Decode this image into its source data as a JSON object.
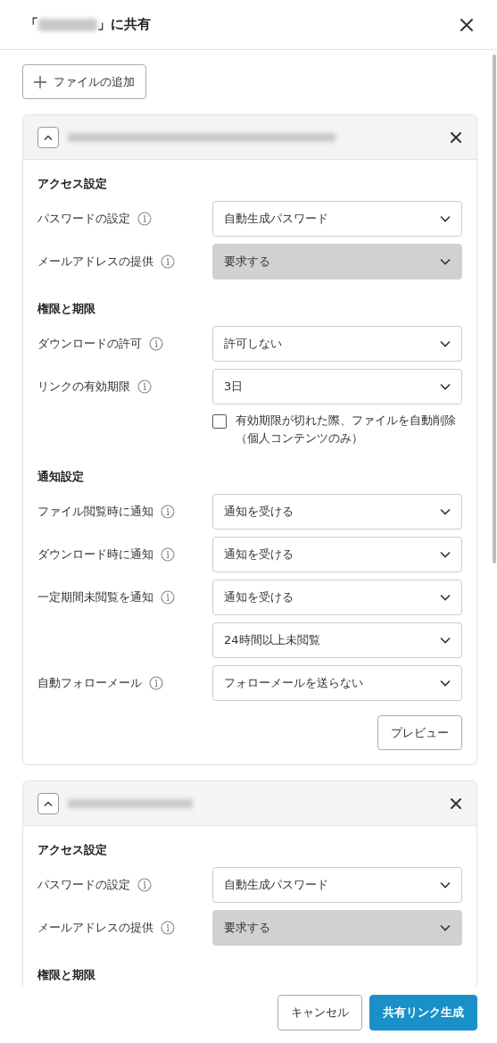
{
  "dialog": {
    "title_prefix": "「",
    "title_redacted": true,
    "title_suffix": "」に共有"
  },
  "add_file_button": "ファイルの追加",
  "files": [
    {
      "name_redacted": true,
      "expanded": true,
      "sections": [
        {
          "title": "アクセス設定",
          "rows": [
            {
              "kind": "select",
              "label": "パスワードの設定",
              "value": "自動生成パスワード",
              "disabled": false
            },
            {
              "kind": "select",
              "label": "メールアドレスの提供",
              "value": "要求する",
              "disabled": true
            }
          ]
        },
        {
          "title": "権限と期限",
          "rows": [
            {
              "kind": "select",
              "label": "ダウンロードの許可",
              "value": "許可しない",
              "disabled": false
            },
            {
              "kind": "select",
              "label": "リンクの有効期限",
              "value": "3日",
              "disabled": false
            },
            {
              "kind": "checkbox",
              "text": "有効期限が切れた際、ファイルを自動削除（個人コンテンツのみ）",
              "checked": false
            }
          ]
        },
        {
          "title": "通知設定",
          "rows": [
            {
              "kind": "select",
              "label": "ファイル閲覧時に通知",
              "value": "通知を受ける",
              "disabled": false
            },
            {
              "kind": "select",
              "label": "ダウンロード時に通知",
              "value": "通知を受ける",
              "disabled": false
            },
            {
              "kind": "select",
              "label": "一定期間未閲覧を通知",
              "value": "通知を受ける",
              "disabled": false
            },
            {
              "kind": "select",
              "value": "24時間以上未閲覧",
              "disabled": false
            },
            {
              "kind": "select",
              "label": "自動フォローメール",
              "value": "フォローメールを送らない",
              "disabled": false
            }
          ]
        }
      ],
      "preview_button": "プレビュー"
    },
    {
      "name_redacted": true,
      "expanded": true,
      "sections": [
        {
          "title": "アクセス設定",
          "rows": [
            {
              "kind": "select",
              "label": "パスワードの設定",
              "value": "自動生成パスワード",
              "disabled": false
            },
            {
              "kind": "select",
              "label": "メールアドレスの提供",
              "value": "要求する",
              "disabled": true
            }
          ]
        },
        {
          "title": "権限と期限"
        }
      ]
    }
  ],
  "footer": {
    "cancel": "キャンセル",
    "submit": "共有リンク生成"
  }
}
